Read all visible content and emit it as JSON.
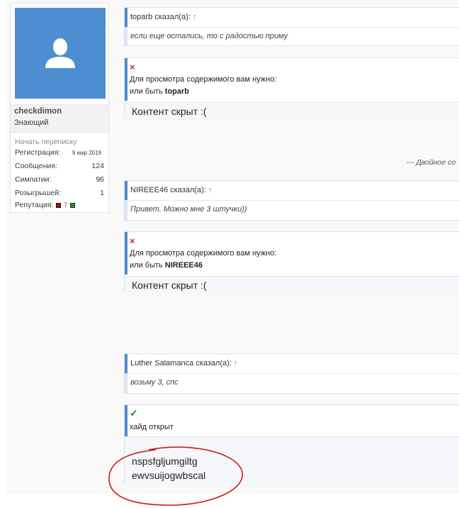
{
  "user": {
    "username": "checkdimon",
    "title": "Знающий",
    "start_conversation": "Начать переписку",
    "stats": [
      {
        "label": "Регистрация:",
        "value": "9 мар 2019"
      },
      {
        "label": "Сообщения:",
        "value": "124"
      },
      {
        "label": "Симпатии:",
        "value": "96"
      },
      {
        "label": "Розыгрышей:",
        "value": "1"
      }
    ],
    "reputation_label": "Репутация:",
    "reputation_value": "7"
  },
  "posts": [
    {
      "quote_author": "toparb сказал(а):",
      "quote_text": "если еще остались, то с радостью приму",
      "hide_line1": "Для просмотра содержимого вам нужно:",
      "hide_line2_prefix": "или быть ",
      "hide_line2_user": "toparb",
      "hidden_text": "Контент скрыт :("
    },
    {
      "quote_author": "NIREEE46 сказал(а):",
      "quote_text": "Привет. Можно мне 3 штучки))",
      "hide_line1": "Для просмотра содержимого вам нужно:",
      "hide_line2_prefix": "или быть ",
      "hide_line2_user": "NIREEE46",
      "hidden_text": "Контент скрыт :("
    },
    {
      "quote_author": "Luther Salamanca сказал(а):",
      "quote_text": "возьму 3, спс",
      "open_text": "хайд открыт",
      "code_lines": [
        "nspsfgljumgiltg",
        "ewvsuijogwbscal"
      ]
    }
  ],
  "double_post_text": "--- Двойное со",
  "quote_arrow": "↑",
  "icons": {
    "cross": "×",
    "check": "✓"
  },
  "colors": {
    "accent": "#4e8ed0",
    "cross": "#d32020",
    "check": "#2f8a2f",
    "annotation": "#d11a1a"
  }
}
